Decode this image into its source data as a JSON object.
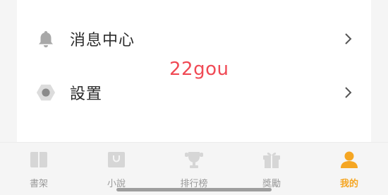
{
  "menu": {
    "items": [
      {
        "label": "消息中心",
        "icon": "bell-icon"
      },
      {
        "label": "設置",
        "icon": "gear-icon"
      }
    ]
  },
  "watermark": {
    "text": "22gou"
  },
  "tabbar": {
    "tabs": [
      {
        "label": "書架",
        "icon": "book-icon",
        "active": false
      },
      {
        "label": "小說",
        "icon": "bag-icon",
        "active": false
      },
      {
        "label": "排行榜",
        "icon": "trophy-icon",
        "active": false
      },
      {
        "label": "獎勵",
        "icon": "gift-icon",
        "active": false
      },
      {
        "label": "我的",
        "icon": "user-icon",
        "active": true
      }
    ]
  },
  "colors": {
    "accent": "#f5a623",
    "inactive": "#cfcfcf",
    "watermark": "#f04a55"
  }
}
